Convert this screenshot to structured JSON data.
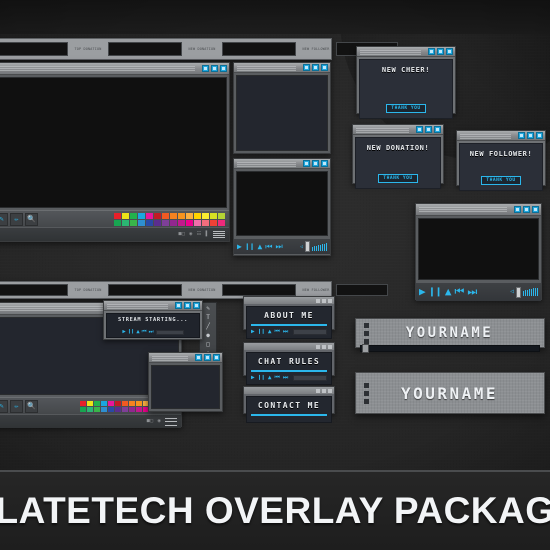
{
  "footer": {
    "title": "SLATETECH OVERLAY PACKAGE"
  },
  "top_tabs": {
    "labels": [
      "Top Donation",
      "New Donation",
      "New Follower"
    ]
  },
  "window_buttons": {
    "minimize": "minimize-button",
    "maximize": "maximize-button",
    "close": "close-button"
  },
  "main_window": {
    "tools": [
      "brush-tool",
      "pencil-tool",
      "magnifier-tool"
    ],
    "palette_row1": [
      "#e8202a",
      "#ece418",
      "#22b24c",
      "#1aa7e0",
      "#e8169c",
      "#c31b24",
      "#f05a22",
      "#f58220",
      "#f7941e",
      "#fbb040",
      "#ffd400",
      "#f9ec31",
      "#d7df23",
      "#b5d334"
    ],
    "palette_row2": [
      "#18a551",
      "#2bb673",
      "#39b54a",
      "#2e8fd0",
      "#2a49a5",
      "#5b2d8e",
      "#7e3f98",
      "#92278f",
      "#c1198c",
      "#ec008c",
      "#f06eaa",
      "#f26d7d",
      "#ef4136",
      "#ee2a7b"
    ],
    "status_icons": [
      "battery-icon",
      "network-icon",
      "signal-icon",
      "volume-icon",
      "menu-icon"
    ]
  },
  "media_controls": {
    "play": "▶",
    "pause": "❙❙",
    "stop": "▲",
    "prev": "⏮",
    "next": "⏭",
    "speaker": "◁"
  },
  "alerts": [
    {
      "id": "cheer",
      "message": "NEW CHEER!",
      "button": "THANK YOU"
    },
    {
      "id": "donation",
      "message": "NEW DONATION!",
      "button": "THANK YOU"
    },
    {
      "id": "follower",
      "message": "NEW FOLLOWER!",
      "button": "THANK YOU"
    }
  ],
  "stream_starting": {
    "title": "STREAM STARTING..."
  },
  "panels": [
    {
      "id": "about",
      "title": "ABOUT ME"
    },
    {
      "id": "chat",
      "title": "CHAT RULES"
    },
    {
      "id": "contact",
      "title": "CONTACT ME"
    }
  ],
  "banners": [
    {
      "id": "banner-1",
      "name": "YOURNAME"
    },
    {
      "id": "banner-2",
      "name": "YOURNAME"
    }
  ],
  "vertical_tools": [
    "brush-icon",
    "text-icon",
    "line-icon",
    "fill-icon",
    "shape-icon",
    "eyedropper-icon"
  ],
  "colors": {
    "accent": "#2bb7ec",
    "chrome_light": "#a9acae",
    "chrome_mid": "#5a5d60",
    "screen_dark": "#101010",
    "screen_navy": "#23262e",
    "background": "#262626"
  }
}
